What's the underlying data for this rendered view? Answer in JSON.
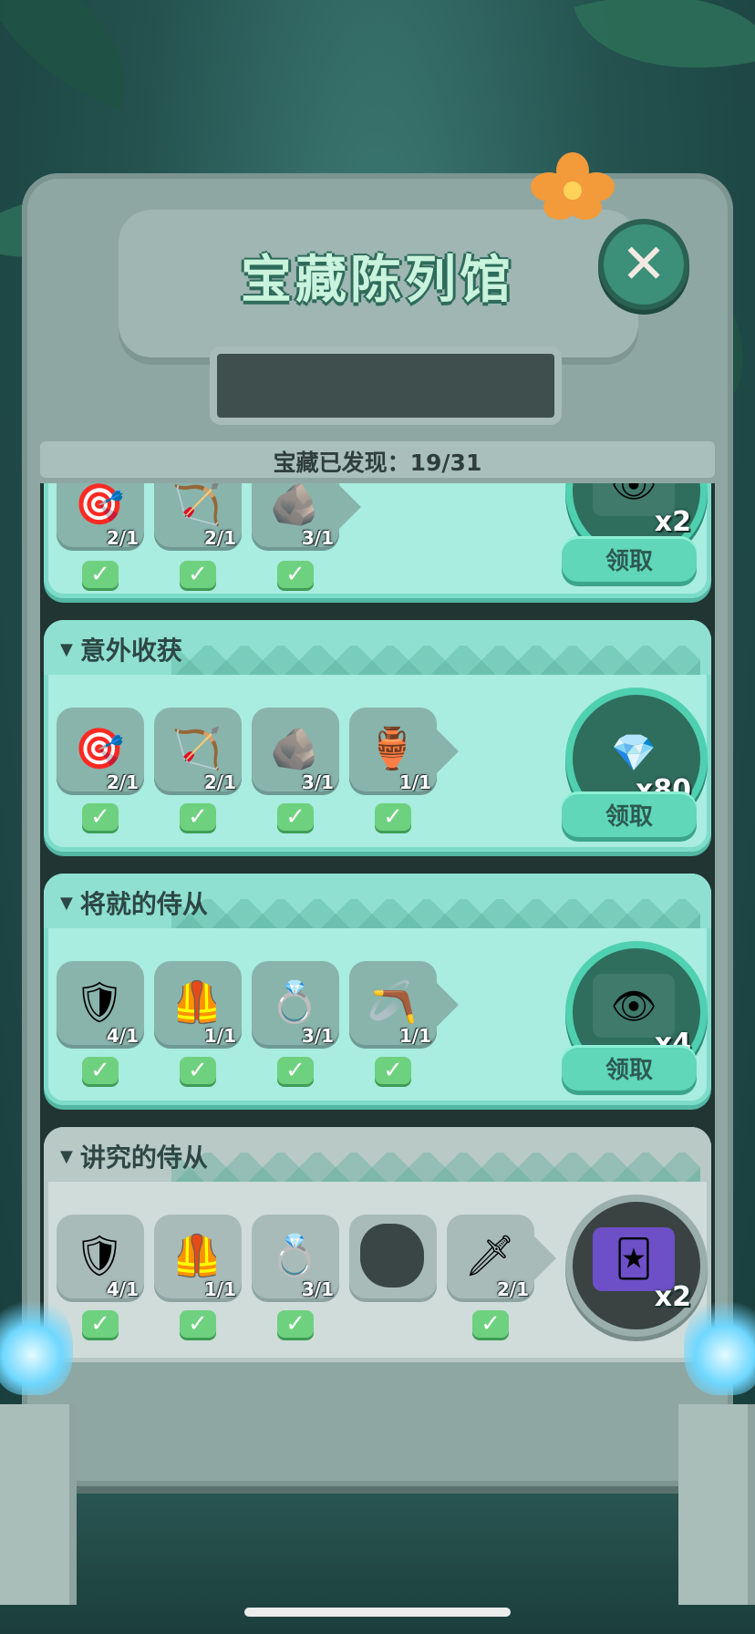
{
  "header": {
    "title": "宝藏陈列馆",
    "close_label": "✕",
    "progress_text": "宝藏已发现：19/31"
  },
  "icons": {
    "close": "close-icon",
    "check": "checkmark-icon",
    "collapse": "chevron-down-icon"
  },
  "colors": {
    "card_active": "#a9ece0",
    "card_locked": "#cfdcda",
    "claim_button": "#5fd7b8",
    "check": "#6ed17f"
  },
  "partial_card": {
    "items": [
      {
        "icon": "target-shield-icon",
        "glyph": "🎯",
        "count": "2/1"
      },
      {
        "icon": "bow-icon",
        "glyph": "🏹",
        "count": "2/1"
      },
      {
        "icon": "serpent-stone-icon",
        "glyph": "🪨",
        "count": "3/1"
      }
    ],
    "reward": {
      "icon": "eye-card-icon",
      "glyph": "👁",
      "count": "x2"
    },
    "claim_label": "领取"
  },
  "cards": [
    {
      "title": "意外收获",
      "items": [
        {
          "icon": "target-shield-icon",
          "glyph": "🎯",
          "count": "2/1",
          "checked": true
        },
        {
          "icon": "bow-icon",
          "glyph": "🏹",
          "count": "2/1",
          "checked": true
        },
        {
          "icon": "serpent-stone-icon",
          "glyph": "🪨",
          "count": "3/1",
          "checked": true
        },
        {
          "icon": "clay-tablet-icon",
          "glyph": "🏺",
          "count": "1/1",
          "checked": true
        }
      ],
      "reward": {
        "icon": "purple-gems-icon",
        "glyph": "💎",
        "count": "x80"
      },
      "claim_label": "领取"
    },
    {
      "title": "将就的侍从",
      "items": [
        {
          "icon": "mickey-shield-icon",
          "glyph": "🛡",
          "count": "4/1",
          "checked": true
        },
        {
          "icon": "golden-armor-icon",
          "glyph": "🦺",
          "count": "1/1",
          "checked": true
        },
        {
          "icon": "golden-ring-icon",
          "glyph": "💍",
          "count": "3/1",
          "checked": true
        },
        {
          "icon": "slingshot-icon",
          "glyph": "🪃",
          "count": "1/1",
          "checked": true
        }
      ],
      "reward": {
        "icon": "eye-card-icon",
        "glyph": "👁",
        "count": "x4"
      },
      "claim_label": "领取"
    },
    {
      "title": "讲究的侍从",
      "items": [
        {
          "icon": "mickey-shield-icon",
          "glyph": "🛡",
          "count": "4/1",
          "checked": true
        },
        {
          "icon": "golden-armor-icon",
          "glyph": "🦺",
          "count": "1/1",
          "checked": true
        },
        {
          "icon": "golden-ring-icon",
          "glyph": "💍",
          "count": "3/1",
          "checked": true
        },
        {
          "icon": "unknown-item-icon",
          "glyph": "",
          "count": "",
          "checked": false
        },
        {
          "icon": "crystal-sword-icon",
          "glyph": "🗡",
          "count": "2/1",
          "checked": true
        }
      ],
      "reward": {
        "icon": "mickey-cards-icon",
        "glyph": "🃏",
        "count": "x2"
      },
      "claim_label": ""
    }
  ]
}
